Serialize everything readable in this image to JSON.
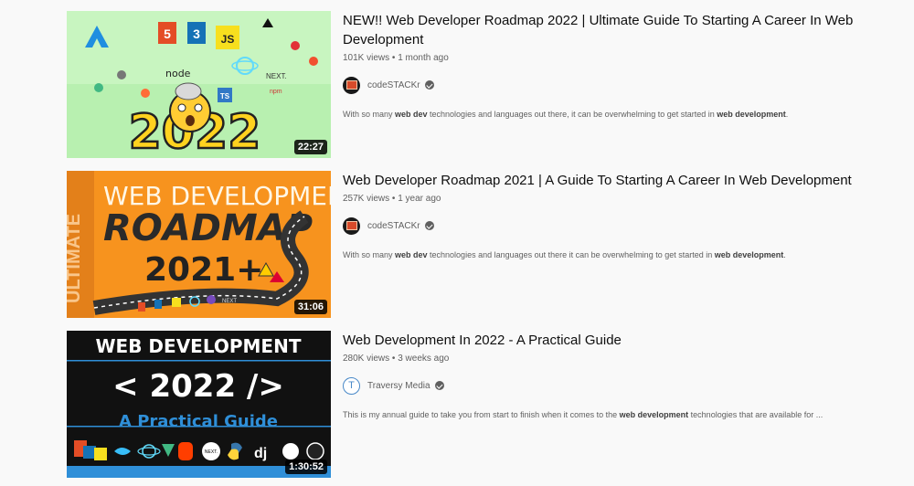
{
  "results": [
    {
      "title": "NEW!! Web Developer Roadmap 2022 | Ultimate Guide To Starting A Career In Web Development",
      "views": "101K views",
      "age": "1 month ago",
      "channel": "codeSTACKr",
      "duration": "22:27",
      "thumb_text": {
        "year": "2022",
        "html": "5",
        "css": "3",
        "js": "JS",
        "node": "node",
        "ts": "TS",
        "next": "NEXT.",
        "npm": "npm"
      },
      "desc_parts": [
        {
          "t": "With so many ",
          "b": false
        },
        {
          "t": "web dev",
          "b": true
        },
        {
          "t": " technologies and languages out there, it can be overwhelming to get started in ",
          "b": false
        },
        {
          "t": "web development",
          "b": true
        },
        {
          "t": ".",
          "b": false
        }
      ]
    },
    {
      "title": "Web Developer Roadmap 2021 | A Guide To Starting A Career In Web Development",
      "views": "257K views",
      "age": "1 year ago",
      "channel": "codeSTACKr",
      "duration": "31:06",
      "thumb_text": {
        "line1": "WEB DEVELOPMENT",
        "line2": "ROADMAP",
        "line3": "2021+",
        "side": "ULTIMATE",
        "next": "NEXT"
      },
      "desc_parts": [
        {
          "t": "With so many ",
          "b": false
        },
        {
          "t": "web dev",
          "b": true
        },
        {
          "t": " technologies and languages out there it can be overwhelming to get started in ",
          "b": false
        },
        {
          "t": "web development",
          "b": true
        },
        {
          "t": ".",
          "b": false
        }
      ]
    },
    {
      "title": "Web Development In 2022 - A Practical Guide",
      "views": "280K views",
      "age": "3 weeks ago",
      "channel": "Traversy Media",
      "channel_initial": "T",
      "duration": "1:30:52",
      "thumb_text": {
        "line1": "WEB DEVELOPMENT",
        "line2": "< 2022 />",
        "line3": "A Practical Guide",
        "dj": "dj",
        "next": "NEXT."
      },
      "desc_parts": [
        {
          "t": "This is my annual guide to take you from start to finish when it comes to the ",
          "b": false
        },
        {
          "t": "web development",
          "b": true
        },
        {
          "t": " technologies that are available for ...",
          "b": false
        }
      ]
    }
  ],
  "colors": {
    "thumb1_bg": "#b8f0b0",
    "thumb2_bg": "#f7931e",
    "thumb3_bg": "#111111",
    "thumb3_accent": "#2f8fd8"
  }
}
